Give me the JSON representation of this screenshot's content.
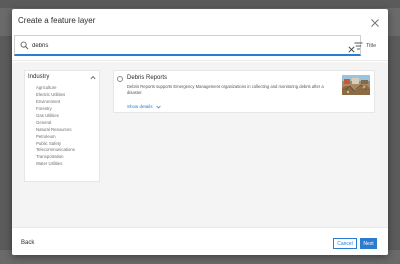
{
  "dialog": {
    "title": "Create a feature layer"
  },
  "search": {
    "value": "debris",
    "sort_label": "Title"
  },
  "filter": {
    "title": "Industry",
    "items": [
      "Agriculture",
      "Electric Utilities",
      "Environment",
      "Forestry",
      "Gas Utilities",
      "General",
      "Natural Resources",
      "Petroleum",
      "Public Safety",
      "Telecommunications",
      "Transportation",
      "Water Utilities"
    ]
  },
  "result": {
    "title": "Debris Reports",
    "description": "Debris Reports supports Emergency Management organizations in collecting and monitoring debris after a disaster.",
    "show_details": "Show details"
  },
  "footer": {
    "back_label": "Back",
    "cancel_label": "Cancel",
    "next_label": "Next"
  },
  "colors": {
    "accent": "#2b7bd0",
    "overlay": "#5b5b5b"
  },
  "icons": {
    "close": "close-icon",
    "search": "search-icon",
    "clear": "clear-icon",
    "sort": "sort-icon",
    "collapse": "chevron-up-icon",
    "expand": "chevron-down-icon"
  }
}
